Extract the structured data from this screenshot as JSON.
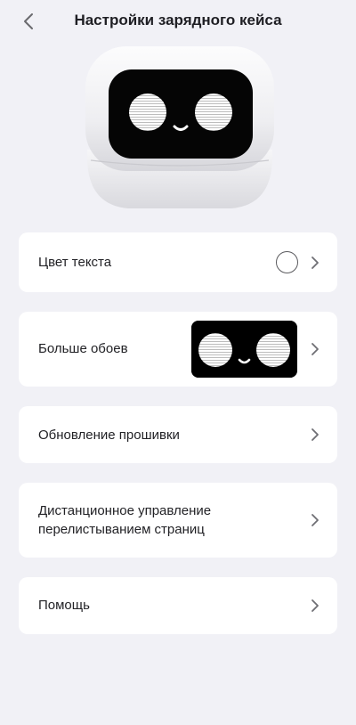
{
  "header": {
    "title": "Настройки зарядного кейса",
    "back_icon": "chevron-left-icon"
  },
  "device": {
    "illustration": "robot-charging-case",
    "face_colors": {
      "body": "#f4f4f6",
      "screen": "#000000",
      "eyes": "#ffffff"
    }
  },
  "settings": {
    "text_color": {
      "label": "Цвет текста",
      "selected_color": "#ffffff"
    },
    "more_wallpapers": {
      "label": "Больше обоев"
    },
    "firmware_update": {
      "label": "Обновление прошивки"
    },
    "remote_page_control": {
      "label": "Дистанционное управление перелистыванием страниц"
    },
    "help": {
      "label": "Помощь"
    }
  },
  "colors": {
    "background": "#f1f1f6",
    "card": "#ffffff",
    "chevron": "#6e6e73"
  }
}
